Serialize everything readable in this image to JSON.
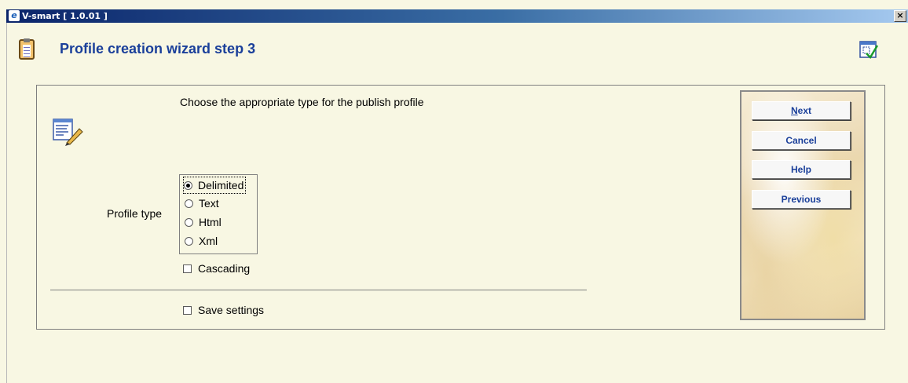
{
  "window": {
    "app_icon_glyph": "e",
    "title": "V-smart [ 1.0.01 ]",
    "close_glyph": "×"
  },
  "header": {
    "title": "Profile creation wizard step 3",
    "page_icon": "clipboard-icon",
    "help_icon": "help-window-icon"
  },
  "form": {
    "instruction": "Choose the appropriate type for the publish profile",
    "form_icon": "edit-form-icon",
    "profile_type_label": "Profile type",
    "profile_types": [
      {
        "label": "Delimited",
        "selected": true
      },
      {
        "label": "Text",
        "selected": false
      },
      {
        "label": "Html",
        "selected": false
      },
      {
        "label": "Xml",
        "selected": false
      }
    ],
    "cascading_label": "Cascading",
    "cascading_checked": false,
    "save_settings_label": "Save settings",
    "save_settings_checked": false
  },
  "buttons": {
    "next_accel": "N",
    "next_rest": "ext",
    "cancel": "Cancel",
    "help": "Help",
    "previous": "Previous"
  },
  "colors": {
    "background": "#f8f7e3",
    "title_blue": "#1a3f9a",
    "titlebar_start": "#0a246a",
    "titlebar_end": "#a6caf0"
  }
}
